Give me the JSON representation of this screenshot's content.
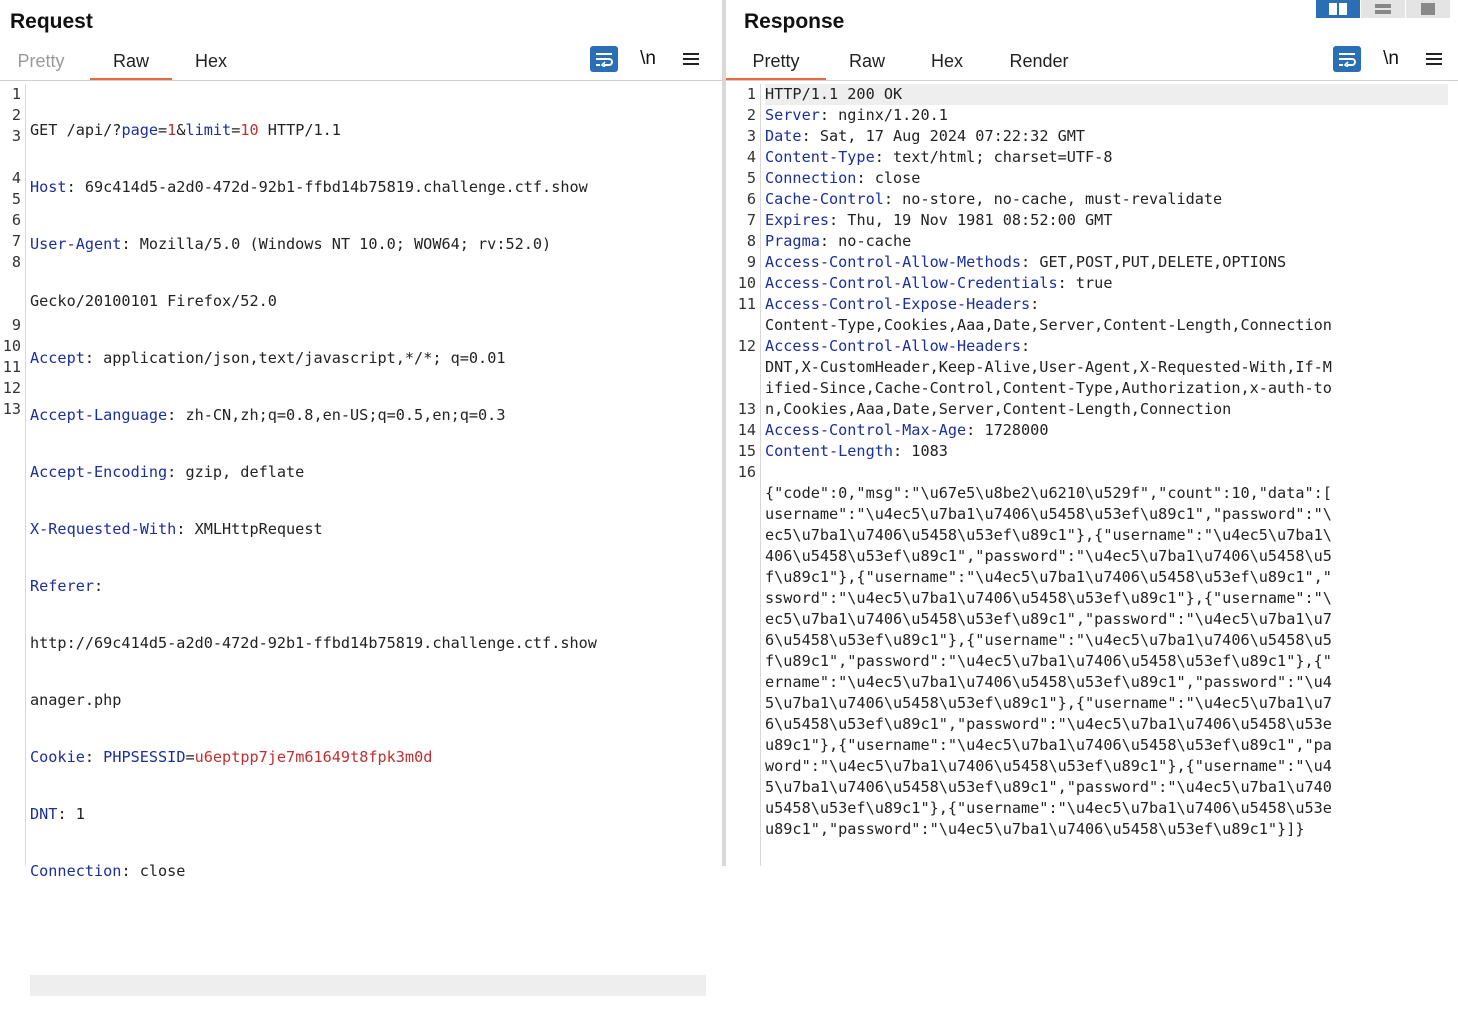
{
  "request": {
    "title": "Request",
    "tabs": [
      {
        "label": "Pretty",
        "state": "disabled"
      },
      {
        "label": "Raw",
        "state": "active"
      },
      {
        "label": "Hex",
        "state": "normal"
      }
    ],
    "newline_label": "\\n",
    "line_numbers": [
      "1",
      "2",
      "3",
      "",
      "4",
      "5",
      "6",
      "7",
      "8",
      "",
      "",
      "9",
      "10",
      "11",
      "12",
      "13"
    ],
    "lines": {
      "l1_method": "GET /api/?",
      "l1_p1": "page",
      "l1_eq1": "=",
      "l1_v1": "1",
      "l1_amp": "&",
      "l1_p2": "limit",
      "l1_eq2": "=",
      "l1_v2": "10",
      "l1_proto": " HTTP/1.1",
      "l2_k": "Host",
      "l2_v": ": 69c414d5-a2d0-472d-92b1-ffbd14b75819.challenge.ctf.show",
      "l3_k": "User-Agent",
      "l3_v": ": Mozilla/5.0 (Windows NT 10.0; WOW64; rv:52.0)",
      "l3_v2": "Gecko/20100101 Firefox/52.0",
      "l4_k": "Accept",
      "l4_v": ": application/json,text/javascript,*/*; q=0.01",
      "l5_k": "Accept-Language",
      "l5_v": ": zh-CN,zh;q=0.8,en-US;q=0.5,en;q=0.3",
      "l6_k": "Accept-Encoding",
      "l6_v": ": gzip, deflate",
      "l7_k": "X-Requested-With",
      "l7_v": ": XMLHttpRequest",
      "l8_k": "Referer",
      "l8_v": ":",
      "l8_v2": "http://69c414d5-a2d0-472d-92b1-ffbd14b75819.challenge.ctf.show",
      "l8_v3": "anager.php",
      "l9_k": "Cookie",
      "l9_sep": ": ",
      "l9_p": "PHPSESSID",
      "l9_eq": "=",
      "l9_val": "u6eptpp7je7m61649t8fpk3m0d",
      "l10_k": "DNT",
      "l10_v": ": 1",
      "l11_k": "Connection",
      "l11_v": ": close"
    }
  },
  "response": {
    "title": "Response",
    "tabs": [
      {
        "label": "Pretty",
        "state": "active"
      },
      {
        "label": "Raw",
        "state": "normal"
      },
      {
        "label": "Hex",
        "state": "normal"
      },
      {
        "label": "Render",
        "state": "normal"
      }
    ],
    "newline_label": "\\n",
    "line_numbers": [
      "1",
      "2",
      "3",
      "4",
      "5",
      "6",
      "7",
      "8",
      "9",
      "10",
      "11",
      "",
      "12",
      "",
      "",
      "13",
      "14",
      "15",
      "16",
      "",
      "",
      "",
      "",
      "",
      "",
      "",
      "",
      "",
      "",
      "",
      "",
      "",
      "",
      "",
      "",
      ""
    ],
    "headers": [
      {
        "k": "",
        "v": "HTTP/1.1 200 OK"
      },
      {
        "k": "Server",
        "v": ": nginx/1.20.1"
      },
      {
        "k": "Date",
        "v": ": Sat, 17 Aug 2024 07:22:32 GMT"
      },
      {
        "k": "Content-Type",
        "v": ": text/html; charset=UTF-8"
      },
      {
        "k": "Connection",
        "v": ": close"
      },
      {
        "k": "Cache-Control",
        "v": ": no-store, no-cache, must-revalidate"
      },
      {
        "k": "Expires",
        "v": ": Thu, 19 Nov 1981 08:52:00 GMT"
      },
      {
        "k": "Pragma",
        "v": ": no-cache"
      },
      {
        "k": "Access-Control-Allow-Methods",
        "v": ": GET,POST,PUT,DELETE,OPTIONS"
      },
      {
        "k": "Access-Control-Allow-Credentials",
        "v": ": true"
      },
      {
        "k": "Access-Control-Expose-Headers",
        "v": ":"
      },
      {
        "k": "",
        "v": "Content-Type,Cookies,Aaa,Date,Server,Content-Length,Connection"
      },
      {
        "k": "Access-Control-Allow-Headers",
        "v": ":"
      },
      {
        "k": "",
        "v": "DNT,X-CustomHeader,Keep-Alive,User-Agent,X-Requested-With,If-M"
      },
      {
        "k": "",
        "v": "ified-Since,Cache-Control,Content-Type,Authorization,x-auth-to"
      },
      {
        "k": "",
        "v": "n,Cookies,Aaa,Date,Server,Content-Length,Connection"
      },
      {
        "k": "Access-Control-Max-Age",
        "v": ": 1728000"
      },
      {
        "k": "Content-Length",
        "v": ": 1083"
      },
      {
        "k": "",
        "v": ""
      }
    ],
    "body_lines": [
      "{\"code\":0,\"msg\":\"\\u67e5\\u8be2\\u6210\\u529f\",\"count\":10,\"data\":[",
      "username\":\"\\u4ec5\\u7ba1\\u7406\\u5458\\u53ef\\u89c1\",\"password\":\"\\",
      "ec5\\u7ba1\\u7406\\u5458\\u53ef\\u89c1\"},{\"username\":\"\\u4ec5\\u7ba1\\",
      "406\\u5458\\u53ef\\u89c1\",\"password\":\"\\u4ec5\\u7ba1\\u7406\\u5458\\u5",
      "f\\u89c1\"},{\"username\":\"\\u4ec5\\u7ba1\\u7406\\u5458\\u53ef\\u89c1\",\"",
      "ssword\":\"\\u4ec5\\u7ba1\\u7406\\u5458\\u53ef\\u89c1\"},{\"username\":\"\\",
      "ec5\\u7ba1\\u7406\\u5458\\u53ef\\u89c1\",\"password\":\"\\u4ec5\\u7ba1\\u7",
      "6\\u5458\\u53ef\\u89c1\"},{\"username\":\"\\u4ec5\\u7ba1\\u7406\\u5458\\u5",
      "f\\u89c1\",\"password\":\"\\u4ec5\\u7ba1\\u7406\\u5458\\u53ef\\u89c1\"},{\"",
      "ername\":\"\\u4ec5\\u7ba1\\u7406\\u5458\\u53ef\\u89c1\",\"password\":\"\\u4",
      "5\\u7ba1\\u7406\\u5458\\u53ef\\u89c1\"},{\"username\":\"\\u4ec5\\u7ba1\\u7",
      "6\\u5458\\u53ef\\u89c1\",\"password\":\"\\u4ec5\\u7ba1\\u7406\\u5458\\u53e",
      "u89c1\"},{\"username\":\"\\u4ec5\\u7ba1\\u7406\\u5458\\u53ef\\u89c1\",\"pa",
      "word\":\"\\u4ec5\\u7ba1\\u7406\\u5458\\u53ef\\u89c1\"},{\"username\":\"\\u4",
      "5\\u7ba1\\u7406\\u5458\\u53ef\\u89c1\",\"password\":\"\\u4ec5\\u7ba1\\u740",
      "u5458\\u53ef\\u89c1\"},{\"username\":\"\\u4ec5\\u7ba1\\u7406\\u5458\\u53e",
      "u89c1\",\"password\":\"\\u4ec5\\u7ba1\\u7406\\u5458\\u53ef\\u89c1\"}]}"
    ]
  },
  "colors": {
    "accent_tab": "#e8683d",
    "button_blue": "#2a6fb5",
    "header_key": "#1b2f9b",
    "param_value": "#c03030"
  }
}
